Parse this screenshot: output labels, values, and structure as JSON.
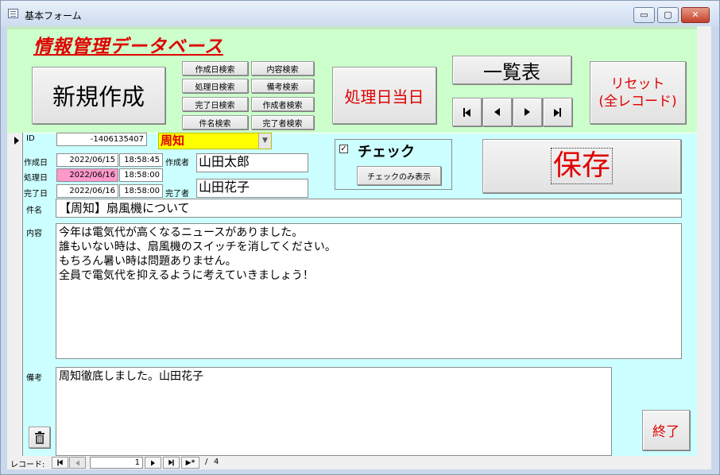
{
  "window": {
    "title": "基本フォーム",
    "min_glyph": "▭",
    "max_glyph": "▢",
    "close_glyph": "✕"
  },
  "header": {
    "app_title": "情報管理データベース",
    "new_button": "新規作成",
    "search_buttons": {
      "created_date": "作成日検索",
      "processed_date": "処理日検索",
      "completed_date": "完了日検索",
      "subject": "件名検索",
      "content": "内容検索",
      "remarks": "備考検索",
      "creator": "作成者検索",
      "completer": "完了者検索"
    },
    "today_button": "処理日当日",
    "list_button": "一覧表",
    "reset_button_line1": "リセット",
    "reset_button_line2": "(全レコード)"
  },
  "record": {
    "id_label": "ID",
    "id_value": "-1406135407",
    "category_value": "周知",
    "created_label": "作成日",
    "created_date": "2022/06/15",
    "created_time": "18:58:45",
    "creator_label": "作成者",
    "creator_value": "山田太郎",
    "processed_label": "処理日",
    "processed_date": "2022/06/16",
    "processed_time": "18:58:00",
    "completed_label": "完了日",
    "completed_date": "2022/06/16",
    "completed_time": "18:58:00",
    "completer_label": "完了者",
    "completer_value": "山田花子",
    "check_label": "チェック",
    "check_checked": true,
    "check_only_button": "チェックのみ表示",
    "save_button": "保存",
    "subject_label": "件名",
    "subject_value": "【周知】扇風機について",
    "content_label": "内容",
    "content_value": "今年は電気代が高くなるニュースがありました。\n誰もいない時は、扇風機のスイッチを消してください。\nもちろん暑い時は問題ありません。\n全員で電気代を抑えるように考えていきましょう！",
    "remarks_label": "備考",
    "remarks_value": "周知徹底しました。山田花子",
    "exit_button": "終了"
  },
  "navigation": {
    "record_label": "レコード:",
    "current": "1",
    "separator": "/",
    "total": "4",
    "new_record_glyph": "▶*"
  },
  "colors": {
    "header_bg": "#ccffcc",
    "detail_bg": "#ccffff",
    "title_red": "#e00000",
    "category_yellow": "#ffff00",
    "processed_pink": "#ff99cc"
  }
}
